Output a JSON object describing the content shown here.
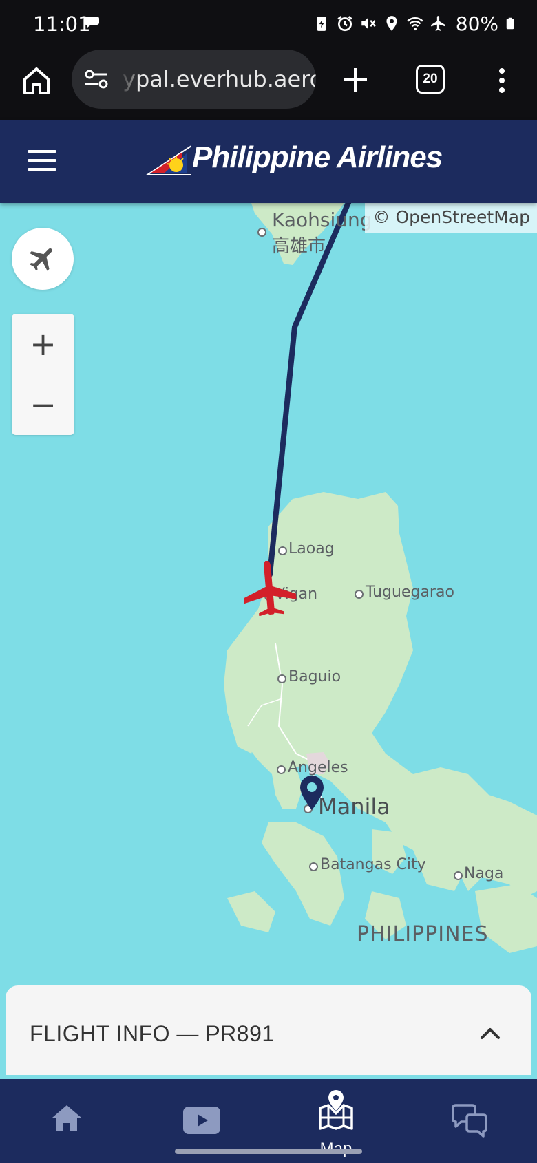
{
  "status_bar": {
    "time": "11:01",
    "battery": "80%"
  },
  "browser": {
    "url": "pal.everhub.aero",
    "url_prefix": "y",
    "tab_count": "20"
  },
  "header": {
    "brand": "Philippine Airlines"
  },
  "map": {
    "attribution": "© OpenStreetMap",
    "labels": {
      "kaohsiung": "Kaohsiung",
      "kaohsiung_native": "高雄市",
      "laoag": "Laoag",
      "vigan": "Vigan",
      "tuguegarao": "Tuguegarao",
      "baguio": "Baguio",
      "angeles": "Angeles",
      "manila": "Manila",
      "batangas": "Batangas City",
      "naga": "Naga",
      "country": "PHILIPPINES"
    },
    "zoom_in": "+",
    "zoom_out": "−",
    "colors": {
      "water": "#7edde6",
      "land": "#cdeac7",
      "route": "#1c2b5e",
      "aircraft": "#d3202a"
    }
  },
  "flight_info": {
    "title": "FLIGHT INFO — PR891"
  },
  "bottom_nav": {
    "items": [
      {
        "icon": "home-icon",
        "label": ""
      },
      {
        "icon": "video-icon",
        "label": ""
      },
      {
        "icon": "map-icon",
        "label": "Map"
      },
      {
        "icon": "chat-icon",
        "label": ""
      }
    ]
  }
}
